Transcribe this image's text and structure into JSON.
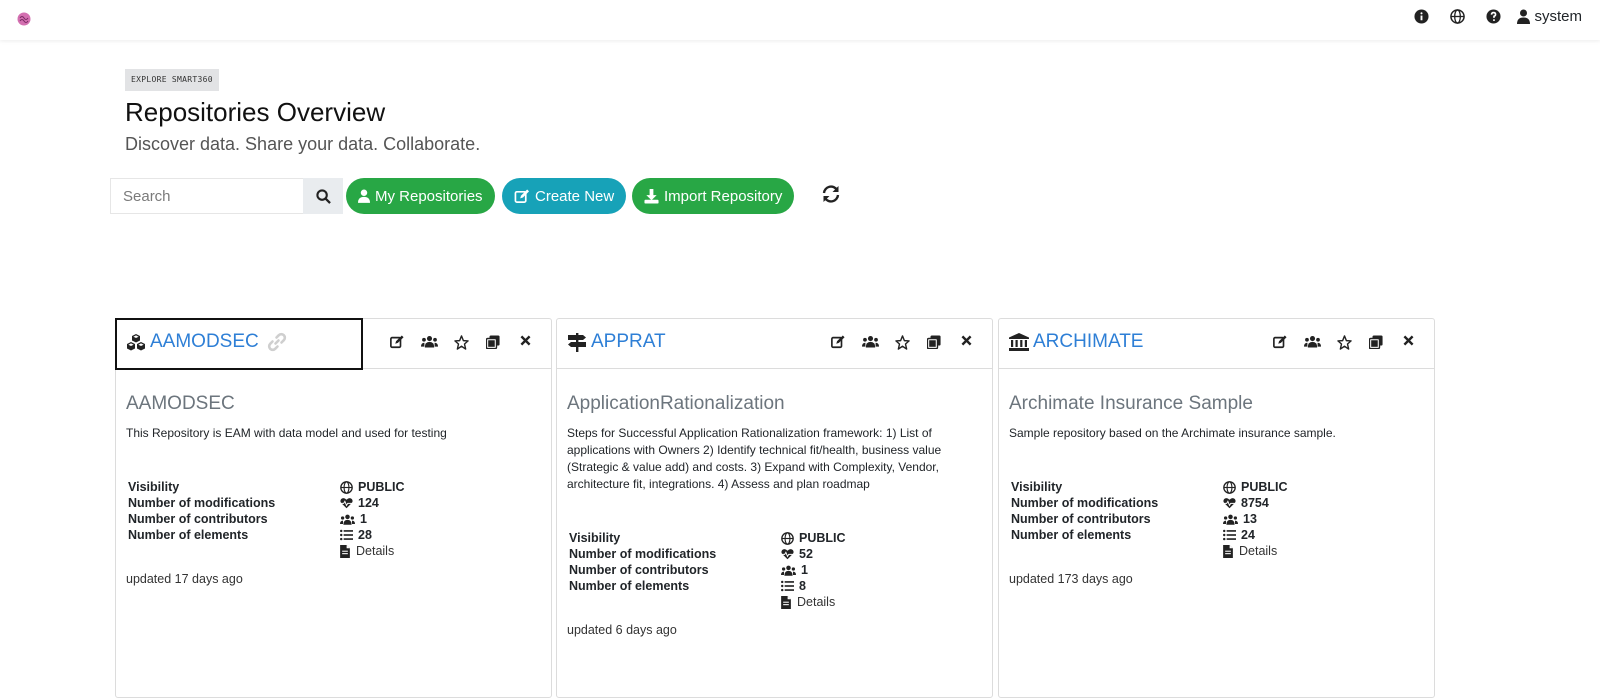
{
  "navbar": {
    "username": "system",
    "icons": [
      "info-icon",
      "globe-icon",
      "help-icon",
      "user-icon"
    ]
  },
  "header": {
    "badge": "EXPLORE SMART360",
    "title": "Repositories Overview",
    "subtitle": "Discover data. Share your data. Collaborate."
  },
  "toolbar": {
    "search_placeholder": "Search",
    "my_repos_label": "My Repositories",
    "create_new_label": "Create New",
    "import_label": "Import Repository"
  },
  "colors": {
    "green": "#28a745",
    "teal": "#17a2b8",
    "link": "#2e7fd6"
  },
  "labels": {
    "visibility": "Visibility",
    "modifications": "Number of modifications",
    "contributors": "Number of contributors",
    "elements": "Number of elements",
    "details": "Details"
  },
  "cards": [
    {
      "code": "AAMODSEC",
      "icon": "cubes-icon",
      "name": "AAMODSEC",
      "description": "This Repository is EAM with data model and used for testing",
      "visibility": "PUBLIC",
      "modifications": "124",
      "contributors": "1",
      "elements": "28",
      "updated": "updated 17 days ago"
    },
    {
      "code": "APPRAT",
      "icon": "signpost-icon",
      "name": "ApplicationRationalization",
      "description": "Steps for Successful Application Rationalization framework: 1) List of applications with Owners 2) Identify technical fit/health, business value (Strategic & value add) and costs. 3) Expand with Complexity, Vendor, architecture fit, integrations. 4) Assess and plan roadmap",
      "visibility": "PUBLIC",
      "modifications": "52",
      "contributors": "1",
      "elements": "8",
      "updated": "updated 6 days ago"
    },
    {
      "code": "ARCHIMATE",
      "icon": "bank-icon",
      "name": "Archimate Insurance Sample",
      "description": "Sample repository based on the Archimate insurance sample.",
      "visibility": "PUBLIC",
      "modifications": "8754",
      "contributors": "13",
      "elements": "24",
      "updated": "updated 173 days ago"
    }
  ]
}
